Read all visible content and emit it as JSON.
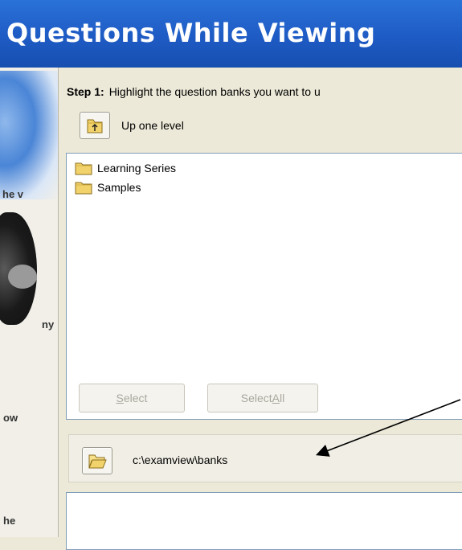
{
  "title": "Questions While Viewing",
  "left_fragments": [
    "he v",
    "ny",
    "ow",
    "he"
  ],
  "step": {
    "label": "Step 1:",
    "text": "Highlight the question banks you want to u"
  },
  "up_one_level": {
    "icon": "folder-up-icon",
    "label": "Up one level"
  },
  "folders": [
    {
      "icon": "folder-icon",
      "label": "Learning Series"
    },
    {
      "icon": "folder-icon",
      "label": "Samples"
    }
  ],
  "buttons": {
    "select": {
      "pre": "",
      "accel": "S",
      "post": "elect"
    },
    "select_all": {
      "pre": "Select ",
      "accel": "A",
      "post": "ll"
    }
  },
  "path": {
    "icon": "folder-open-icon",
    "value": "c:\\examview\\banks"
  },
  "colors": {
    "title_bar": "#1e5bc4",
    "window_bg": "#ece9d8",
    "folder": "#f2d36b",
    "list_border": "#7f9db9"
  }
}
